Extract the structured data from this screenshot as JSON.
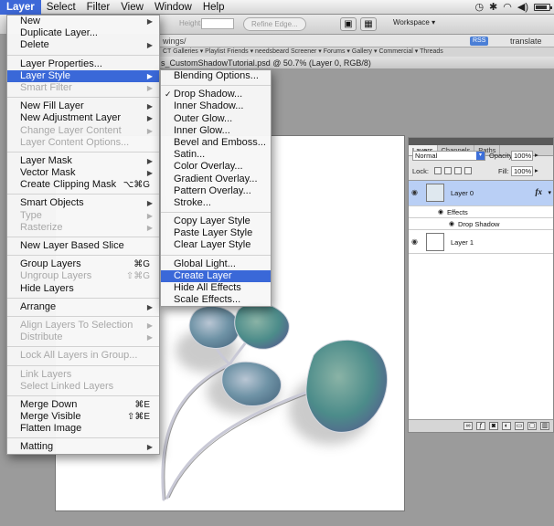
{
  "menubar": {
    "items": [
      "Layer",
      "Select",
      "Filter",
      "View",
      "Window",
      "Help"
    ],
    "active": "Layer"
  },
  "optionsbar": {
    "height_label": "Height:",
    "refine_label": "Refine Edge...",
    "workspace_label": "Workspace ▾"
  },
  "browser": {
    "url_fragment": "wings/",
    "rss": "RSS",
    "translate": "translate",
    "bookmarks": "CT Galleries ▾   Playlist Friends ▾   needsbeard   Screener ▾   Forums ▾   Gallery ▾   Commercial ▾   Threads"
  },
  "document": {
    "title": "s_CustomShadowTutorial.psd @ 50.7% (Layer 0, RGB/8)"
  },
  "layer_menu": [
    {
      "label": "New",
      "arrow": true
    },
    {
      "label": "Duplicate Layer..."
    },
    {
      "label": "Delete",
      "arrow": true
    },
    {
      "sep": true
    },
    {
      "label": "Layer Properties..."
    },
    {
      "label": "Layer Style",
      "arrow": true,
      "highlight": true
    },
    {
      "label": "Smart Filter",
      "arrow": true,
      "disabled": true
    },
    {
      "sep": true
    },
    {
      "label": "New Fill Layer",
      "arrow": true
    },
    {
      "label": "New Adjustment Layer",
      "arrow": true
    },
    {
      "label": "Change Layer Content",
      "arrow": true,
      "disabled": true
    },
    {
      "label": "Layer Content Options...",
      "disabled": true
    },
    {
      "sep": true
    },
    {
      "label": "Layer Mask",
      "arrow": true
    },
    {
      "label": "Vector Mask",
      "arrow": true
    },
    {
      "label": "Create Clipping Mask",
      "shortcut": "⌥⌘G"
    },
    {
      "sep": true
    },
    {
      "label": "Smart Objects",
      "arrow": true
    },
    {
      "label": "Type",
      "arrow": true,
      "disabled": true
    },
    {
      "label": "Rasterize",
      "arrow": true,
      "disabled": true
    },
    {
      "sep": true
    },
    {
      "label": "New Layer Based Slice"
    },
    {
      "sep": true
    },
    {
      "label": "Group Layers",
      "shortcut": "⌘G"
    },
    {
      "label": "Ungroup Layers",
      "shortcut": "⇧⌘G",
      "disabled": true
    },
    {
      "label": "Hide Layers"
    },
    {
      "sep": true
    },
    {
      "label": "Arrange",
      "arrow": true
    },
    {
      "sep": true
    },
    {
      "label": "Align Layers To Selection",
      "arrow": true,
      "disabled": true
    },
    {
      "label": "Distribute",
      "arrow": true,
      "disabled": true
    },
    {
      "sep": true
    },
    {
      "label": "Lock All Layers in Group...",
      "disabled": true
    },
    {
      "sep": true
    },
    {
      "label": "Link Layers",
      "disabled": true
    },
    {
      "label": "Select Linked Layers",
      "disabled": true
    },
    {
      "sep": true
    },
    {
      "label": "Merge Down",
      "shortcut": "⌘E"
    },
    {
      "label": "Merge Visible",
      "shortcut": "⇧⌘E"
    },
    {
      "label": "Flatten Image"
    },
    {
      "sep": true
    },
    {
      "label": "Matting",
      "arrow": true
    }
  ],
  "style_menu": [
    {
      "label": "Blending Options..."
    },
    {
      "sep": true
    },
    {
      "label": "Drop Shadow...",
      "checked": true
    },
    {
      "label": "Inner Shadow..."
    },
    {
      "label": "Outer Glow..."
    },
    {
      "label": "Inner Glow..."
    },
    {
      "label": "Bevel and Emboss..."
    },
    {
      "label": "Satin..."
    },
    {
      "label": "Color Overlay..."
    },
    {
      "label": "Gradient Overlay..."
    },
    {
      "label": "Pattern Overlay..."
    },
    {
      "label": "Stroke..."
    },
    {
      "sep": true
    },
    {
      "label": "Copy Layer Style"
    },
    {
      "label": "Paste Layer Style"
    },
    {
      "label": "Clear Layer Style"
    },
    {
      "sep": true
    },
    {
      "label": "Global Light..."
    },
    {
      "label": "Create Layer",
      "highlight": true
    },
    {
      "label": "Hide All Effects"
    },
    {
      "label": "Scale Effects..."
    }
  ],
  "layers_panel": {
    "tabs": [
      "Layers",
      "Channels",
      "Paths"
    ],
    "blend_mode": "Normal",
    "opacity_label": "Opacity:",
    "opacity_value": "100%",
    "lock_label": "Lock:",
    "fill_label": "Fill:",
    "fill_value": "100%",
    "layer0_name": "Layer 0",
    "fx_label": "fx",
    "effects_label": "Effects",
    "drop_shadow_label": "Drop Shadow",
    "layer1_name": "Layer 1"
  },
  "colors": {
    "highlight": "#3a68d8",
    "selected_layer": "#b9cff5"
  }
}
